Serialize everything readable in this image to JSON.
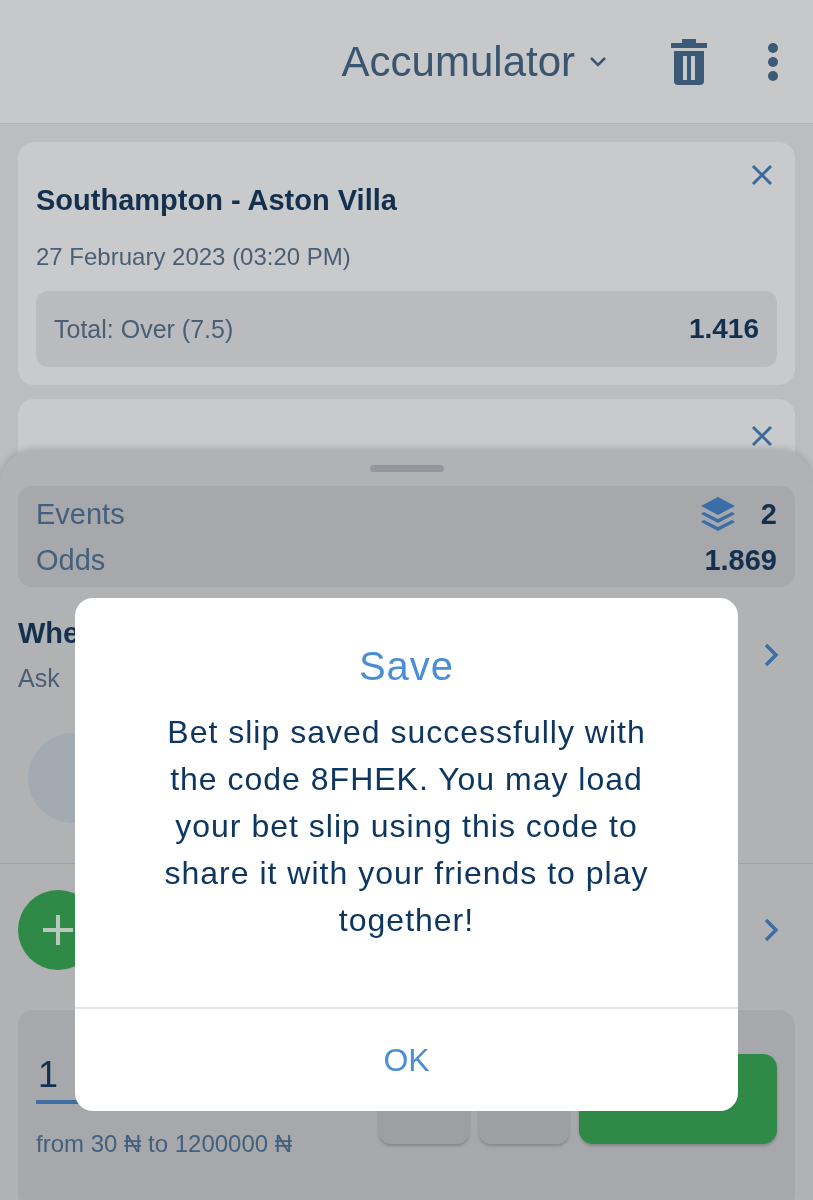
{
  "header": {
    "title": "Accumulator"
  },
  "bets": [
    {
      "match": "Southampton - Aston Villa",
      "date": "27 February 2023 (03:20 PM)",
      "market": "Total: Over (7.5)",
      "odds": "1.416"
    }
  ],
  "summary": [
    {
      "label": "Events",
      "value": "2",
      "kind": "count"
    },
    {
      "label": "Odds",
      "value": "1.869",
      "kind": "plain"
    }
  ],
  "option": {
    "title": "Whe",
    "subtitle": "Ask"
  },
  "stake": {
    "value": "1",
    "range": "from 30 ₦ to 1200000 ₦"
  },
  "dialog": {
    "title": "Save",
    "message": "Bet slip saved successfully with the code 8FHEK. You may load your bet slip using this code to share it with your friends to play together!",
    "button": "OK"
  }
}
